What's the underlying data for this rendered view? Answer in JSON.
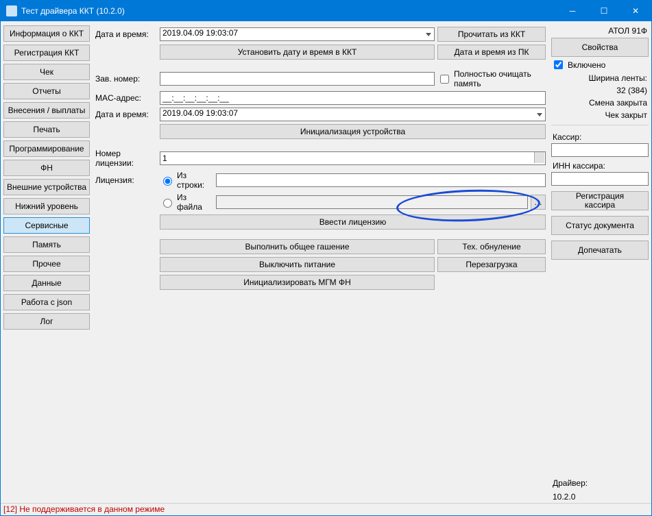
{
  "title": "Тест драйвера ККТ (10.2.0)",
  "nav": [
    "Информация о ККТ",
    "Регистрация ККТ",
    "Чек",
    "Отчеты",
    "Внесения / выплаты",
    "Печать",
    "Программирование",
    "ФН",
    "Внешние устройства",
    "Нижний уровень",
    "Сервисные",
    "Память",
    "Прочее",
    "Данные",
    "Работа с json",
    "Лог"
  ],
  "activeNav": 10,
  "labels": {
    "datetime": "Дата и время:",
    "serial": "Зав. номер:",
    "mac": "MAC-адрес:",
    "licenseNo": "Номер лицензии:",
    "license": "Лицензия:",
    "fromString": "Из строки:",
    "fromFile": "Из файла"
  },
  "values": {
    "datetime1": "2019.04.09 19:03:07",
    "serial": "",
    "mac": "__:__:__:__:__:__",
    "datetime2": "2019.04.09 19:03:07",
    "licenseNo": "1",
    "licStr": "",
    "licFile": ""
  },
  "buttons": {
    "readKkt": "Прочитать из ККТ",
    "setDt": "Установить дату и время в ККТ",
    "dtFromPc": "Дата и время из ПК",
    "initDevice": "Инициализация устройства",
    "setLicense": "Ввести лицензию",
    "generalErase": "Выполнить общее гашение",
    "techReset": "Тех. обнуление",
    "powerOff": "Выключить питание",
    "reboot": "Перезагрузка",
    "initMgm": "Инициализировать МГМ ФН",
    "browse": "…"
  },
  "chk": {
    "clearMem": "Полностью очищать память"
  },
  "right": {
    "model": "АТОЛ 91Ф",
    "props": "Свойства",
    "enabled": "Включено",
    "tapeW": "Ширина ленты:",
    "tapeV": "32 (384)",
    "shift": "Смена закрыта",
    "check": "Чек закрыт",
    "cashier": "Кассир:",
    "inn": "ИНН кассира:",
    "regCashier": "Регистрация\nкассира",
    "docStatus": "Статус документа",
    "finishPrint": "Допечатать",
    "driver": "Драйвер:",
    "version": "10.2.0"
  },
  "status": "[12] Не поддерживается в данном режиме"
}
